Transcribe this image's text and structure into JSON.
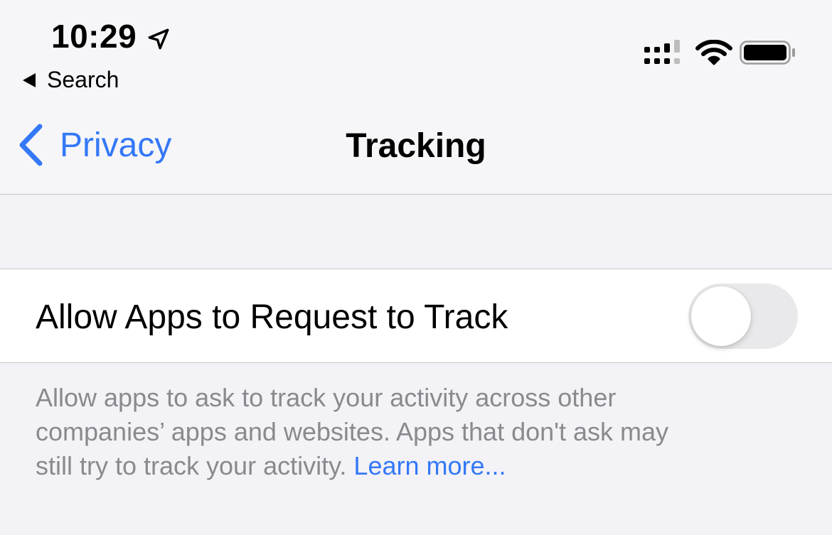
{
  "status_bar": {
    "time": "10:29",
    "back_app": "Search",
    "icons": [
      "location-arrow-icon",
      "signal-icon",
      "wifi-icon",
      "battery-icon"
    ]
  },
  "nav": {
    "back_label": "Privacy",
    "title": "Tracking"
  },
  "setting": {
    "label": "Allow Apps to Request to Track",
    "toggle_on": false
  },
  "footer": {
    "line1": "Allow apps to ask to track your activity across other",
    "line2": "companies’ apps and websites. Apps that don't ask may",
    "line3_prefix": "still try to track your activity. ",
    "link": "Learn more..."
  },
  "colors": {
    "accent": "#3478f6",
    "background": "#f2f2f7",
    "secondary_text": "#8a8a8e",
    "toggle_off": "#e9e9eb"
  }
}
